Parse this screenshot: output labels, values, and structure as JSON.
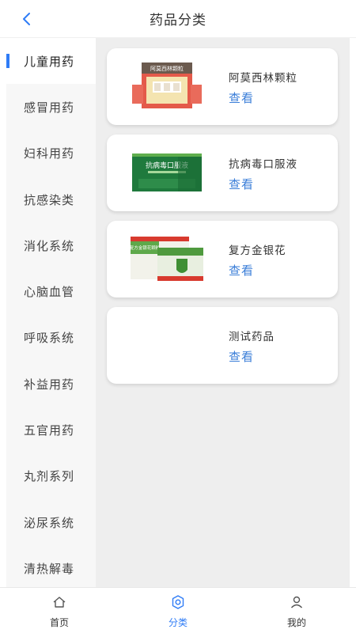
{
  "header": {
    "title": "药品分类"
  },
  "sidebar": {
    "items": [
      {
        "label": "儿童用药",
        "active": true
      },
      {
        "label": "感冒用药"
      },
      {
        "label": "妇科用药"
      },
      {
        "label": "抗感染类"
      },
      {
        "label": "消化系统"
      },
      {
        "label": "心脑血管"
      },
      {
        "label": "呼吸系统"
      },
      {
        "label": "补益用药"
      },
      {
        "label": "五官用药"
      },
      {
        "label": "丸剂系列"
      },
      {
        "label": "泌尿系统"
      },
      {
        "label": "清热解毒"
      }
    ]
  },
  "products": [
    {
      "name": "阿莫西林颗粒",
      "action": "查看",
      "box_text": "阿莫西林颗粒"
    },
    {
      "name": "抗病毒口服液",
      "action": "查看",
      "box_text": "抗病毒口服液"
    },
    {
      "name": "复方金银花",
      "action": "查看",
      "box_text": "复方金银花颗粒"
    },
    {
      "name": "测试药品",
      "action": "查看"
    }
  ],
  "tabbar": {
    "items": [
      {
        "label": "首页",
        "icon": "home-icon"
      },
      {
        "label": "分类",
        "icon": "category-icon",
        "active": true
      },
      {
        "label": "我的",
        "icon": "profile-icon"
      }
    ]
  },
  "colors": {
    "accent": "#2f7cf6",
    "link": "#3a7ed8",
    "content_bg": "#eeeeee",
    "sidebar_bg": "#f7f7f7"
  }
}
